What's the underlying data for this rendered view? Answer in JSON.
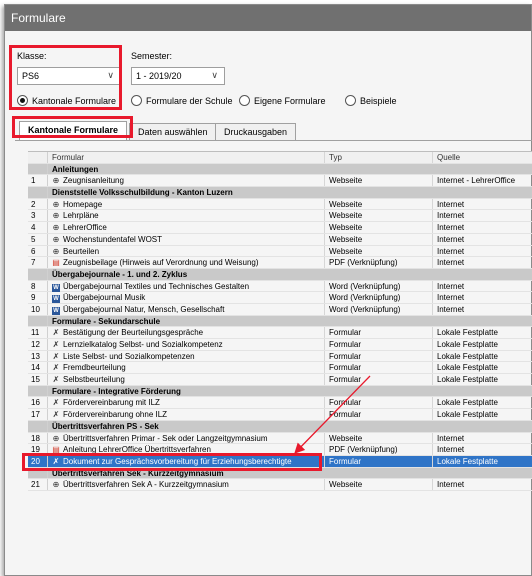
{
  "window": {
    "title": "Formulare"
  },
  "filters": {
    "klasse_label": "Klasse:",
    "klasse_value": "PS6",
    "semester_label": "Semester:",
    "semester_value": "1 - 2019/20",
    "chevron_icon": "chevron-down"
  },
  "radios": [
    {
      "label": "Kantonale Formulare",
      "selected": true
    },
    {
      "label": "Formulare der Schule",
      "selected": false
    },
    {
      "label": "Eigene Formulare",
      "selected": false
    },
    {
      "label": "Beispiele",
      "selected": false
    }
  ],
  "tabs": [
    {
      "label": "Kantonale Formulare",
      "active": true
    },
    {
      "label": "Daten auswählen",
      "active": false
    },
    {
      "label": "Druckausgaben",
      "active": false
    }
  ],
  "table": {
    "columns": [
      "",
      "Formular",
      "Typ",
      "Quelle"
    ],
    "rows": [
      {
        "kind": "group",
        "name": "Anleitungen"
      },
      {
        "kind": "item",
        "nr": "1",
        "icon": "web",
        "name": "Zeugnisanleitung",
        "typ": "Webseite",
        "quelle": "Internet - LehrerOffice"
      },
      {
        "kind": "group",
        "name": "Dienststelle Volksschulbildung - Kanton Luzern"
      },
      {
        "kind": "item",
        "nr": "2",
        "icon": "web",
        "name": "Homepage",
        "typ": "Webseite",
        "quelle": "Internet"
      },
      {
        "kind": "item",
        "nr": "3",
        "icon": "web",
        "name": "Lehrpläne",
        "typ": "Webseite",
        "quelle": "Internet"
      },
      {
        "kind": "item",
        "nr": "4",
        "icon": "web",
        "name": "LehrerOffice",
        "typ": "Webseite",
        "quelle": "Internet"
      },
      {
        "kind": "item",
        "nr": "5",
        "icon": "web",
        "name": "Wochenstundentafel WOST",
        "typ": "Webseite",
        "quelle": "Internet"
      },
      {
        "kind": "item",
        "nr": "6",
        "icon": "web",
        "name": "Beurteilen",
        "typ": "Webseite",
        "quelle": "Internet"
      },
      {
        "kind": "item",
        "nr": "7",
        "icon": "pdf",
        "name": "Zeugnisbeilage (Hinweis auf Verordnung und Weisung)",
        "typ": "PDF (Verknüpfung)",
        "quelle": "Internet"
      },
      {
        "kind": "group",
        "name": "Übergabejournale - 1. und 2. Zyklus"
      },
      {
        "kind": "item",
        "nr": "8",
        "icon": "word",
        "name": "Übergabejournal Textiles und Technisches Gestalten",
        "typ": "Word (Verknüpfung)",
        "quelle": "Internet"
      },
      {
        "kind": "item",
        "nr": "9",
        "icon": "word",
        "name": "Übergabejournal Musik",
        "typ": "Word (Verknüpfung)",
        "quelle": "Internet"
      },
      {
        "kind": "item",
        "nr": "10",
        "icon": "word",
        "name": "Übergabejournal Natur, Mensch, Gesellschaft",
        "typ": "Word (Verknüpfung)",
        "quelle": "Internet"
      },
      {
        "kind": "group",
        "name": "Formulare - Sekundarschule"
      },
      {
        "kind": "item",
        "nr": "11",
        "icon": "form",
        "name": "Bestätigung der Beurteilungsgespräche",
        "typ": "Formular",
        "quelle": "Lokale Festplatte"
      },
      {
        "kind": "item",
        "nr": "12",
        "icon": "form",
        "name": "Lernzielkatalog Selbst- und Sozialkompetenz",
        "typ": "Formular",
        "quelle": "Lokale Festplatte"
      },
      {
        "kind": "item",
        "nr": "13",
        "icon": "form",
        "name": "Liste Selbst- und Sozialkompetenzen",
        "typ": "Formular",
        "quelle": "Lokale Festplatte"
      },
      {
        "kind": "item",
        "nr": "14",
        "icon": "form",
        "name": "Fremdbeurteilung",
        "typ": "Formular",
        "quelle": "Lokale Festplatte"
      },
      {
        "kind": "item",
        "nr": "15",
        "icon": "form",
        "name": "Selbstbeurteilung",
        "typ": "Formular",
        "quelle": "Lokale Festplatte"
      },
      {
        "kind": "group",
        "name": "Formulare - Integrative Förderung"
      },
      {
        "kind": "item",
        "nr": "16",
        "icon": "form",
        "name": "Fördervereinbarung mit ILZ",
        "typ": "Formular",
        "quelle": "Lokale Festplatte"
      },
      {
        "kind": "item",
        "nr": "17",
        "icon": "form",
        "name": "Fördervereinbarung ohne ILZ",
        "typ": "Formular",
        "quelle": "Lokale Festplatte"
      },
      {
        "kind": "group",
        "name": "Übertrittsverfahren PS - Sek"
      },
      {
        "kind": "item",
        "nr": "18",
        "icon": "web",
        "name": "Übertrittsverfahren Primar - Sek oder Langzeitgymnasium",
        "typ": "Webseite",
        "quelle": "Internet"
      },
      {
        "kind": "item",
        "nr": "19",
        "icon": "pdf",
        "name": "Anleitung LehrerOffice Übertrittsverfahren",
        "typ": "PDF (Verknüpfung)",
        "quelle": "Internet"
      },
      {
        "kind": "item",
        "nr": "20",
        "icon": "form",
        "name": "Dokument zur Gesprächsvorbereitung für Erziehungsberechtigte",
        "typ": "Formular",
        "quelle": "Lokale Festplatte",
        "selected": true
      },
      {
        "kind": "group",
        "name": "Übertrittsverfahren Sek - Kurzzeitgymnasium"
      },
      {
        "kind": "item",
        "nr": "21",
        "icon": "web",
        "name": "Übertrittsverfahren Sek A - Kurzzeitgymnasium",
        "typ": "Webseite",
        "quelle": "Internet"
      }
    ]
  },
  "icon_glyphs": {
    "web": "⊕",
    "pdf": "▤",
    "word": "W",
    "form": "✗"
  },
  "colors": {
    "highlight": "#e8192c",
    "selection": "#2f74c7",
    "group_bg": "#c9c9c9",
    "title_bg": "#707070"
  }
}
